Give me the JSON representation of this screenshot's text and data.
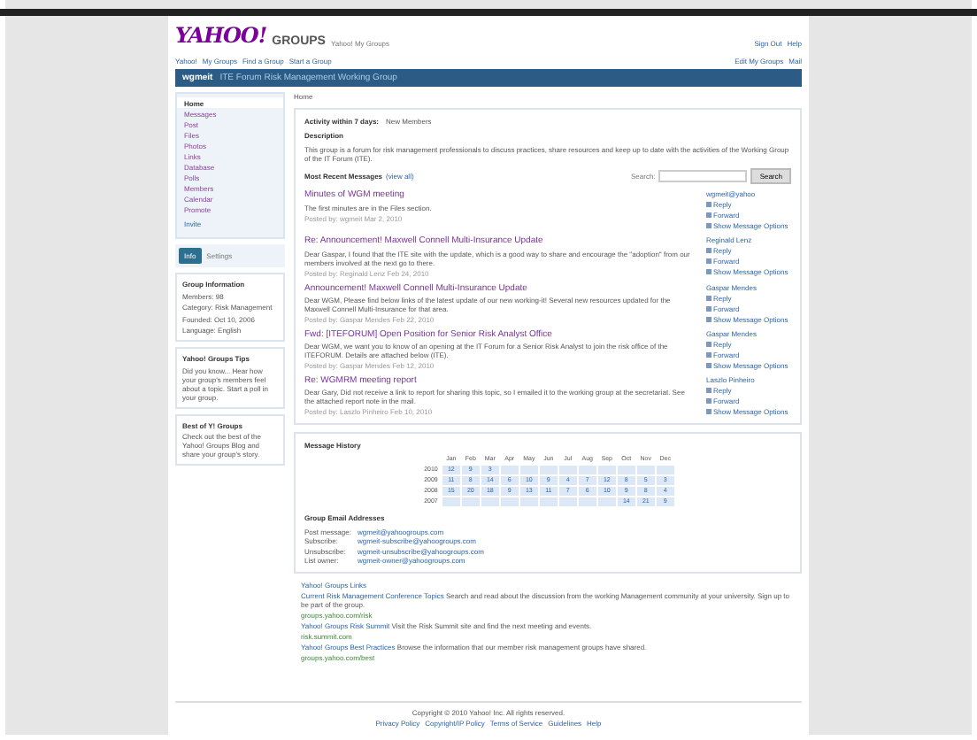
{
  "header": {
    "logo_main": "YAHOO!",
    "logo_sub": "GROUPS",
    "tagline": "Yahoo! My Groups",
    "top_links": [
      "Sign Out",
      "Help"
    ],
    "nav_links": [
      "Yahoo!",
      "My Groups",
      "Find a Group",
      "Start a Group"
    ],
    "nav_right": [
      "Edit My Groups",
      "Mail"
    ]
  },
  "group_bar": {
    "name": "wgmeit",
    "title": "ITE Forum Risk Management Working Group"
  },
  "sidebar": {
    "items": [
      {
        "label": "Home",
        "selected": true
      },
      {
        "label": "Messages",
        "selected": false
      },
      {
        "label": "Post",
        "selected": false
      },
      {
        "label": "Files",
        "selected": false
      },
      {
        "label": "Photos",
        "selected": false
      },
      {
        "label": "Links",
        "selected": false
      },
      {
        "label": "Database",
        "selected": false
      },
      {
        "label": "Polls",
        "selected": false
      },
      {
        "label": "Members",
        "selected": false
      },
      {
        "label": "Calendar",
        "selected": false
      },
      {
        "label": "Promote",
        "selected": false
      }
    ],
    "more": "Invite",
    "info_tab": "Info",
    "info_tab2": "Settings",
    "group_info_title": "Group Information",
    "group_info": [
      "Members: 98",
      "Category: Risk Management",
      "Founded: Oct 10, 2006",
      "Language: English"
    ],
    "tips_title": "Yahoo! Groups Tips",
    "tips_text": "Did you know... Hear how your group's members feel about a topic. Start a poll in your group.",
    "best_title": "Best of Y! Groups",
    "best_text": "Check out the best of the Yahoo! Groups Blog and share your group's story."
  },
  "main": {
    "crumb": "Home",
    "activity": "Activity within 7 days:",
    "activity_value": "New Members",
    "description_title": "Description",
    "description": "This group is a forum for risk management professionals to discuss practices, share resources and keep up to date with the activities of the Working Group of the IT Forum (ITE).",
    "recent_title": "Most Recent Messages",
    "recent_link": "(view all)",
    "search_label": "Search:",
    "search_button": "Search",
    "messages": [
      {
        "title": "Minutes of WGM meeting",
        "snippet": "The first minutes are in the Files section.",
        "meta": "Posted by: wgmeit Mar 2, 2010",
        "author": "wgmeit@yahoo",
        "actions": [
          "Reply",
          "Forward",
          "Show Message Options"
        ]
      },
      {
        "title": "Re: Announcement! Maxwell Connell Multi-Insurance Update",
        "snippet": "Dear Gaspar, I found that the ITE site with the update, which is a good way to share and encourage the \"adoption\" from our members involved at the next go to there.",
        "meta": "Posted by: Reginald Lenz Feb 24, 2010",
        "author": "Reginald Lenz",
        "actions": [
          "Reply",
          "Forward",
          "Show Message Options"
        ]
      },
      {
        "title": "Announcement! Maxwell Connell Multi-Insurance Update",
        "snippet": "Dear WGM, Please find below links of the latest update of our new working-it! Several new resources updated for the Maxwell Connell Multi-Insurance for that area.",
        "meta": "Posted by: Gaspar Mendes Feb 22, 2010",
        "author": "Gaspar Mendes",
        "actions": [
          "Reply",
          "Forward",
          "Show Message Options"
        ]
      },
      {
        "title": "Fwd: [ITEFORUM] Open Position for Senior Risk Analyst Office",
        "snippet": "Dear WGM, we want you to know of an opening at the IT Forum for a Senior Risk Analyst to join the risk office of the ITEFORUM. Details are attached below (ITE).",
        "meta": "Posted by: Gaspar Mendes Feb 12, 2010",
        "author": "Gaspar Mendes",
        "actions": [
          "Reply",
          "Forward",
          "Show Message Options"
        ]
      },
      {
        "title": "Re: WGMRM meeting report",
        "snippet": "Dear Gary, Did not receive a link to report for sharing this topic, so I emailed it to the working group at the secretariat. See the attached report note in the mail.",
        "meta": "Posted by: Laszlo Pinheiro Feb 10, 2010",
        "author": "Laszlo Pinheiro",
        "actions": [
          "Reply",
          "Forward",
          "Show Message Options"
        ]
      }
    ]
  },
  "history": {
    "title": "Message History",
    "months": [
      "Jan",
      "Feb",
      "Mar",
      "Apr",
      "May",
      "Jun",
      "Jul",
      "Aug",
      "Sep",
      "Oct",
      "Nov",
      "Dec"
    ],
    "rows": [
      {
        "year": "2010",
        "kind": "latest",
        "counts": [
          "12",
          "9",
          "3"
        ]
      },
      {
        "year": "2009",
        "kind": "full",
        "counts": [
          "11",
          "8",
          "14",
          "6",
          "10",
          "9",
          "4",
          "7",
          "12",
          "8",
          "5",
          "3"
        ]
      },
      {
        "year": "2008",
        "kind": "full",
        "counts": [
          "15",
          "20",
          "18",
          "9",
          "13",
          "11",
          "7",
          "6",
          "10",
          "9",
          "8",
          "4"
        ]
      },
      {
        "year": "2007",
        "kind": "first",
        "counts": [
          "14",
          "21",
          "9"
        ]
      }
    ]
  },
  "emails": {
    "title": "Group Email Addresses",
    "rows": [
      {
        "label": "Post message:",
        "value": "wgmeit@yahoogroups.com"
      },
      {
        "label": "Subscribe:",
        "value": "wgmeit-subscribe@yahoogroups.com"
      },
      {
        "label": "Unsubscribe:",
        "value": "wgmeit-unsubscribe@yahoogroups.com"
      },
      {
        "label": "List owner:",
        "value": "wgmeit-owner@yahoogroups.com"
      }
    ]
  },
  "promos": {
    "title": "Yahoo! Groups Links",
    "items": [
      {
        "link": "Current Risk Management Conference Topics",
        "text": "Search and read about the discussion from the working Management community at your university. Sign up to be part of the group.",
        "url": "groups.yahoo.com/risk"
      },
      {
        "link": "Yahoo! Groups Risk Summit",
        "text": "Visit the Risk Summit site and find the next meeting and events.",
        "url": "risk.summit.com"
      },
      {
        "link": "Yahoo! Groups Best Practices",
        "text": "Browse the information that our member risk management groups have shared.",
        "url": "groups.yahoo.com/best"
      }
    ]
  },
  "footer": {
    "copyright": "Copyright © 2010 Yahoo! Inc. All rights reserved.",
    "links": [
      "Privacy Policy",
      "Copyright/IP Policy",
      "Terms of Service",
      "Guidelines",
      "Help"
    ]
  }
}
